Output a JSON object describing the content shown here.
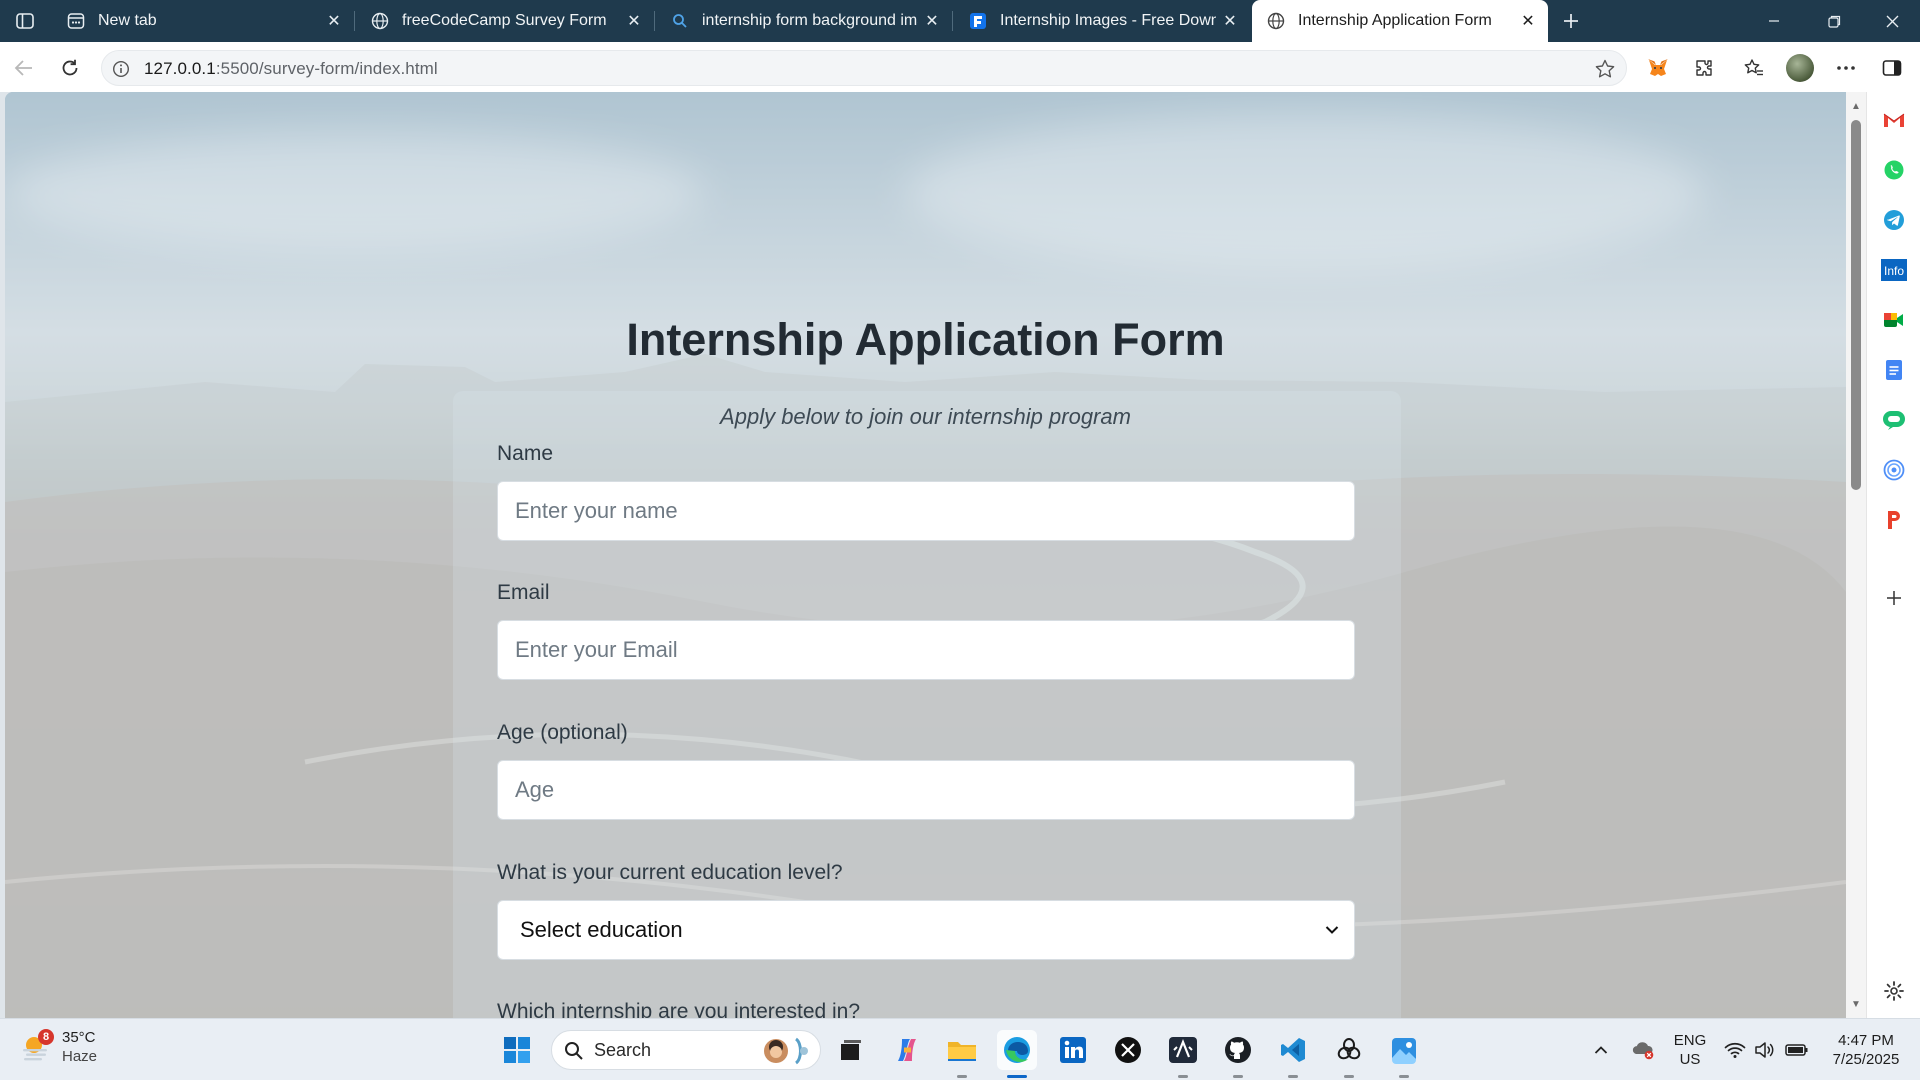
{
  "browser": {
    "tabs": [
      {
        "title": "New tab",
        "icon": "new-tab-page-icon",
        "active": false
      },
      {
        "title": "freeCodeCamp Survey Form",
        "icon": "globe-icon",
        "active": false
      },
      {
        "title": "internship form background imag",
        "icon": "search-icon",
        "active": false
      },
      {
        "title": "Internship Images - Free Downloa",
        "icon": "freepik-icon",
        "active": false
      },
      {
        "title": "Internship Application Form",
        "icon": "globe-icon",
        "active": true
      }
    ],
    "url_host": "127.0.0.1",
    "url_rest": ":5500/survey-form/index.html"
  },
  "page": {
    "title": "Internship Application Form",
    "description": "Apply below to join our internship program",
    "fields": {
      "name": {
        "label": "Name",
        "placeholder": "Enter your name"
      },
      "email": {
        "label": "Email",
        "placeholder": "Enter your Email"
      },
      "age": {
        "label": "Age (optional)",
        "placeholder": "Age"
      },
      "education": {
        "label": "What is your current education level?",
        "selected": "Select education"
      },
      "internship": {
        "label": "Which internship are you interested in?"
      }
    }
  },
  "taskbar": {
    "weather": {
      "badge": "8",
      "temp": "35°C",
      "condition": "Haze"
    },
    "search_label": "Search",
    "language": {
      "line1": "ENG",
      "line2": "US"
    },
    "time": "4:47 PM",
    "date": "7/25/2025"
  },
  "colors": {
    "tabbar": "#1f3a4d",
    "accent": "#0c66c8",
    "title_text": "#222b33"
  }
}
